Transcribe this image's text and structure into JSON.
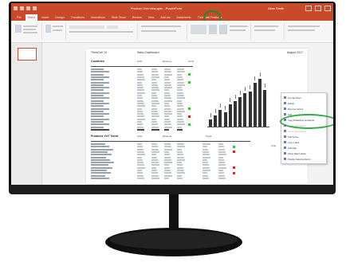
{
  "window": {
    "title": "Product Overview.pptx - PowerPoint",
    "user": "Allan Smith",
    "tabs": [
      "File",
      "Home",
      "Insert",
      "Design",
      "Transitions",
      "Animations",
      "Slide Show",
      "Review",
      "View",
      "Add-ins",
      "Datasheets",
      "Think-cell Features"
    ],
    "active_tab": "Home",
    "highlight_tab": "Add-ins"
  },
  "slide": {
    "header_left": "ThinkCell 10",
    "header_center": "Sales Dashboard",
    "header_right": "August 2017",
    "section1_title": "Countries",
    "section1_col_headers": [
      "Units",
      "Revenue",
      "Trend"
    ],
    "section2_title": "Products YoY Trend",
    "section2_col_headers": [
      "Units",
      "Revenue",
      "Trend"
    ],
    "total_label": "Total",
    "chart_bars": [
      4,
      6,
      9,
      8,
      12,
      14,
      16,
      18,
      19,
      24,
      26,
      20
    ]
  },
  "context_menu": {
    "items": [
      "Format Chart",
      "Delete",
      "Remove Series",
      "Add",
      "Copy Datasheet and Excel",
      "Insert Chart Below",
      "Insert Chart Above",
      "Add Series",
      "Copy Label",
      "Add Gap",
      "Show Data Labels",
      "Display Selected Items"
    ],
    "highlighted_index": 4
  }
}
